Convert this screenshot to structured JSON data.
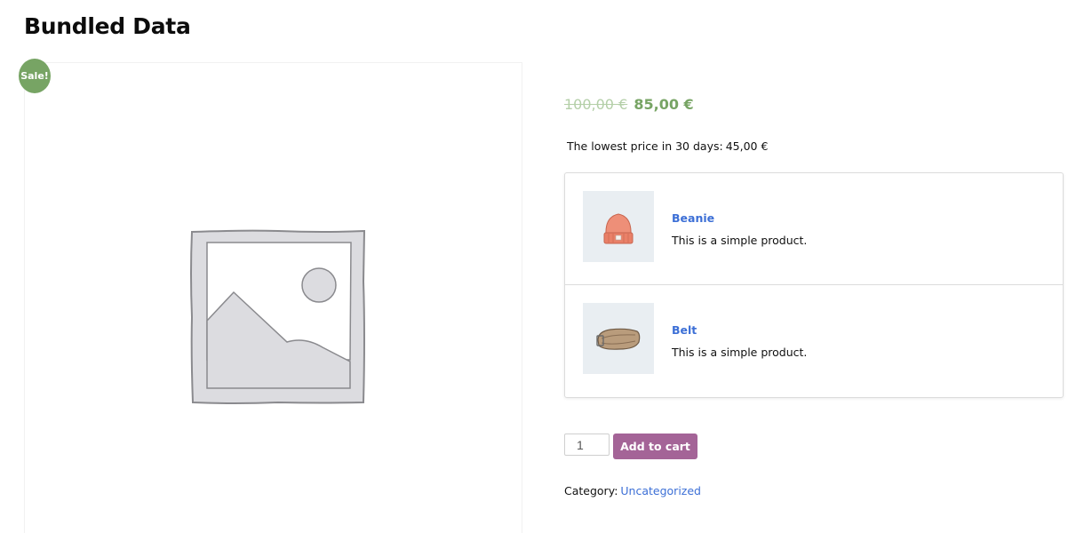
{
  "product": {
    "title": "Bundled Data",
    "sale_badge": "Sale!",
    "price_old": "100,00 €",
    "price_new": "85,00 €",
    "lowest_price_label": "The lowest price in 30 days:",
    "lowest_price_value": "45,00 €"
  },
  "gallery": {
    "image": "placeholder-image-icon"
  },
  "bundle": {
    "items": [
      {
        "name": "Beanie",
        "description": "This is a simple product.",
        "image": "beanie-icon"
      },
      {
        "name": "Belt",
        "description": "This is a simple product.",
        "image": "belt-icon"
      }
    ]
  },
  "cart": {
    "quantity": "1",
    "add_to_cart_label": "Add to cart"
  },
  "meta": {
    "category_label": "Category:",
    "category_value": "Uncategorized"
  },
  "colors": {
    "sale_green": "#77a464",
    "old_price": "#b4cfa8",
    "link_blue": "#3c6fd6",
    "cart_purple": "#a46497",
    "thumb_bg": "#e9eef2"
  }
}
